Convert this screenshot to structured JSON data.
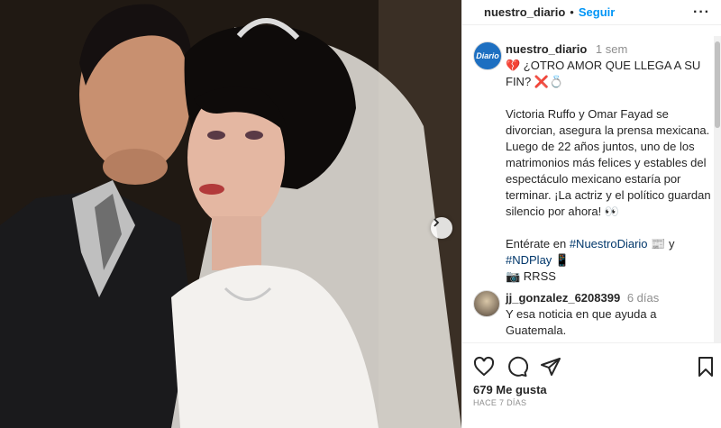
{
  "header": {
    "username": "nuestro_diario",
    "separator": "•",
    "follow_label": "Seguir",
    "more_label": "···"
  },
  "caption": {
    "avatar_text": "Diario",
    "username": "nuestro_diario",
    "time": "1 sem",
    "line1": "💔 ¿OTRO AMOR QUE LLEGA A SU FIN? ❌💍",
    "paragraph": "Victoria Ruffo y Omar Fayad se divorcian, asegura la prensa mexicana. Luego de 22 años juntos, uno de los matrimonios más felices y estables del espectáculo mexicano estaría por terminar. ¡La actriz y el político guardan silencio por ahora! 👀",
    "enterate_prefix": "Entérate en ",
    "hashtag1": "#NuestroDiario",
    "enterate_mid": " 📰 y",
    "hashtag2": "#NDPlay",
    "enterate_suffix": " 📱",
    "source": "📷 RRSS"
  },
  "comment": {
    "username": "jj_gonzalez_6208399",
    "time": "6 días",
    "text": "Y esa noticia en que ayuda a Guatemala."
  },
  "footer": {
    "likes": "679 Me gusta",
    "ago": "HACE 7 DÍAS"
  },
  "icons": [
    "heart-icon",
    "comment-icon",
    "share-icon",
    "bookmark-icon",
    "chevron-right-icon",
    "more-icon"
  ],
  "colors": {
    "accent": "#0095f6",
    "hashtag": "#00376b",
    "muted": "#8e8e8e"
  }
}
